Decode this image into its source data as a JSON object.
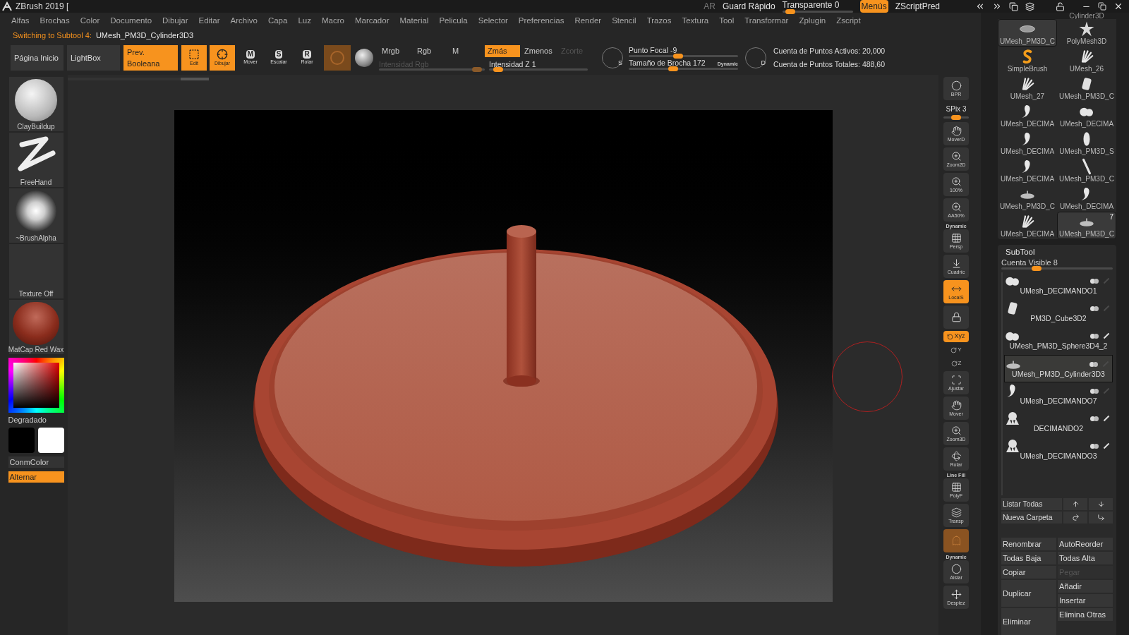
{
  "window": {
    "title": "ZBrush 2019 [",
    "controls": [
      {
        "label": "AR",
        "kind": "dim"
      },
      {
        "label": "Guard Rápido",
        "kind": "text"
      },
      {
        "label": "Transparente 0",
        "kind": "slider",
        "level": 0.05
      },
      {
        "label": "Menús",
        "kind": "active"
      },
      {
        "label": "ZScriptPred",
        "kind": "text"
      }
    ]
  },
  "menu": [
    "Alfas",
    "Brochas",
    "Color",
    "Documento",
    "Dibujar",
    "Editar",
    "Archivo",
    "Capa",
    "Luz",
    "Macro",
    "Marcador",
    "Material",
    "Pelicula",
    "Selector",
    "Preferencias",
    "Render",
    "Stencil",
    "Trazos",
    "Textura",
    "Tool",
    "Transformar",
    "Zplugin",
    "Zscript"
  ],
  "status": {
    "prefix": "Switching to Subtool 4:",
    "value": "UMesh_PM3D_Cylinder3D3"
  },
  "toolbar": {
    "buttons": [
      {
        "label": "Página Inicio",
        "active": false
      },
      {
        "label": "LightBox",
        "active": false
      },
      {
        "label": "Prev. Booleana",
        "active": true
      }
    ],
    "tools": [
      {
        "label": "Edit",
        "kind": "edit",
        "active": true
      },
      {
        "label": "Dibujar",
        "kind": "draw",
        "active": true
      },
      {
        "label": "Mover",
        "kind": "key",
        "key": "M",
        "active": false
      },
      {
        "label": "Escalar",
        "kind": "key",
        "key": "S",
        "active": false
      },
      {
        "label": "Rotar",
        "kind": "key",
        "key": "R",
        "active": false
      }
    ],
    "channels": [
      {
        "label": "Mrgb",
        "selected": false,
        "disabled": false
      },
      {
        "label": "Rgb",
        "selected": false,
        "disabled": false
      },
      {
        "label": "M",
        "selected": false,
        "disabled": false
      },
      {
        "label": "Zmás",
        "selected": true,
        "disabled": false
      },
      {
        "label": "Zmenos",
        "selected": false,
        "disabled": false
      },
      {
        "label": "Zcorte",
        "selected": false,
        "disabled": true
      }
    ],
    "intensities": [
      {
        "label": "Intensidad Rgb",
        "level": 0.97,
        "disabled": true
      },
      {
        "label": "Intensidad Z 1",
        "level": 0.05,
        "disabled": false
      }
    ],
    "focal_key": "S",
    "size_key": "D",
    "brush": [
      {
        "label": "Punto Focal -9",
        "level": 0.45
      },
      {
        "label": "Tamaño de Brocha 172",
        "level": 0.4
      }
    ],
    "dynamic": "Dynamic",
    "counts": [
      "Cuenta de Puntos Activos: 20,000",
      "Cuenta de Puntos Totales: 488,60"
    ]
  },
  "left_shelf": {
    "items": [
      {
        "label": "ClayBuildup",
        "kind": "clay"
      },
      {
        "label": "FreeHand",
        "kind": "stroke"
      },
      {
        "label": "~BrushAlpha",
        "kind": "alpha"
      },
      {
        "label": "Texture Off",
        "kind": "empty"
      },
      {
        "label": "MatCap Red Wax",
        "kind": "matcap"
      }
    ],
    "gradient": "Degradado",
    "swatches": [
      {
        "color": "#000000"
      },
      {
        "color": "#ffffff"
      }
    ],
    "conm": "ConmColor",
    "alternate": {
      "label": "Alternar",
      "active": true
    }
  },
  "right_shelf": [
    {
      "label": "BPR",
      "kind": "sphere",
      "active": false
    },
    {
      "label": "SPix 3",
      "kind": "slider",
      "level": 0.5
    },
    {
      "label": "MoverD",
      "kind": "hand",
      "active": false
    },
    {
      "label": "Zoom2D",
      "kind": "zoom",
      "active": false
    },
    {
      "label": "100%",
      "kind": "zoom",
      "active": false
    },
    {
      "label": "AA50%",
      "kind": "zoom",
      "active": false
    },
    {
      "label": "Persp",
      "kind": "grid",
      "header": "Dynamic",
      "active": false
    },
    {
      "label": "Cuadríc",
      "kind": "floor",
      "active": false
    },
    {
      "label": "LocalS",
      "kind": "local",
      "active": true
    },
    {
      "kind": "lock",
      "active": false
    },
    {
      "label": "Xyz",
      "kind": "xyz",
      "active": true
    },
    {
      "label": "Y",
      "kind": "axis",
      "active": false
    },
    {
      "label": "Z",
      "kind": "axis",
      "active": false
    },
    {
      "label": "Ajustar",
      "kind": "frame",
      "active": false
    },
    {
      "label": "Mover",
      "kind": "hand",
      "active": false
    },
    {
      "label": "Zoom3D",
      "kind": "zoom",
      "active": false
    },
    {
      "label": "Rotar",
      "kind": "rotate",
      "active": false
    },
    {
      "label": "PolyF",
      "kind": "grid",
      "header": "Line Fill",
      "active": false
    },
    {
      "label": "Transp",
      "kind": "layers",
      "active": false
    },
    {
      "kind": "ghost",
      "active": true
    },
    {
      "label": "Aislar",
      "kind": "solo",
      "header": "Dynamic",
      "active": false
    },
    {
      "label": "Despiez",
      "kind": "move",
      "active": false
    }
  ],
  "tool_palette": {
    "partial_label": "Cylinder3D",
    "items": [
      {
        "label": "UMesh_PM3D_C",
        "kind": "disc",
        "selected": true
      },
      {
        "label": "PolyMesh3D",
        "kind": "star",
        "selected": false
      },
      {
        "label": "SimpleBrush",
        "kind": "s",
        "selected": false
      },
      {
        "label": "UMesh_26",
        "kind": "feather",
        "selected": false
      },
      {
        "label": "UMesh_27",
        "kind": "feather",
        "selected": false
      },
      {
        "label": "UMesh_PM3D_C",
        "kind": "block",
        "selected": false
      },
      {
        "label": "UMesh_DECIMA",
        "kind": "figure",
        "selected": false
      },
      {
        "label": "UMesh_DECIMA",
        "kind": "blob",
        "selected": false
      },
      {
        "label": "UMesh_DECIMA",
        "kind": "figure",
        "selected": false
      },
      {
        "label": "UMesh_PM3D_S",
        "kind": "bean",
        "selected": false
      },
      {
        "label": "UMesh_DECIMA",
        "kind": "figure",
        "selected": false
      },
      {
        "label": "UMesh_PM3D_C",
        "kind": "rod",
        "selected": false
      },
      {
        "label": "UMesh_PM3D_C",
        "kind": "pin",
        "selected": false
      },
      {
        "label": "UMesh_DECIMA",
        "kind": "figure",
        "selected": false
      },
      {
        "label": "UMesh_DECIMA",
        "kind": "feather",
        "selected": false
      },
      {
        "label": "UMesh_PM3D_C",
        "kind": "pin",
        "selected": true
      }
    ],
    "last_item_count": "7"
  },
  "subtool": {
    "title": "SubTool",
    "visible": {
      "label": "Cuenta Visible 8",
      "level": 0.3
    },
    "items": [
      {
        "name": "UMesh_DECIMANDO1",
        "kind": "blob",
        "selected": false,
        "polypaint": false
      },
      {
        "name": "PM3D_Cube3D2",
        "kind": "block",
        "selected": false,
        "polypaint": false
      },
      {
        "name": "UMesh_PM3D_Sphere3D4_2",
        "kind": "blob",
        "selected": false,
        "polypaint": true
      },
      {
        "name": "UMesh_PM3D_Cylinder3D3",
        "kind": "pin",
        "selected": true,
        "polypaint": false
      },
      {
        "name": "UMesh_DECIMANDO7",
        "kind": "figure",
        "selected": false,
        "polypaint": false
      },
      {
        "name": "DECIMANDO2",
        "kind": "head",
        "selected": false,
        "polypaint": true
      },
      {
        "name": "UMesh_DECIMANDO3",
        "kind": "head",
        "selected": false,
        "polypaint": true
      }
    ],
    "list_buttons": [
      {
        "label": "Listar Todas"
      },
      {
        "kind": "up"
      },
      {
        "kind": "down"
      },
      {
        "label": "Nueva Carpeta"
      },
      {
        "kind": "redo"
      },
      {
        "kind": "down-right"
      }
    ],
    "actions_left": [
      {
        "label": "Renombrar",
        "disabled": false,
        "tall": false
      },
      {
        "label": "Todas Baja",
        "disabled": false,
        "tall": false
      },
      {
        "label": "Copiar",
        "disabled": false,
        "tall": false
      },
      {
        "label": "Duplicar",
        "disabled": false,
        "tall": true
      },
      {
        "label": "Eliminar",
        "disabled": false,
        "tall": true
      }
    ],
    "actions_right": [
      {
        "label": "AutoReorder",
        "disabled": false,
        "tall": false
      },
      {
        "label": "Todas Alta",
        "disabled": false,
        "tall": false
      },
      {
        "label": "Pegar",
        "disabled": true,
        "tall": false
      },
      {
        "label": "Añadir",
        "disabled": false,
        "tall": false
      },
      {
        "label": "Insertar",
        "disabled": false,
        "tall": false
      },
      {
        "label": "Elimina Otras",
        "disabled": false,
        "tall": false
      }
    ]
  }
}
